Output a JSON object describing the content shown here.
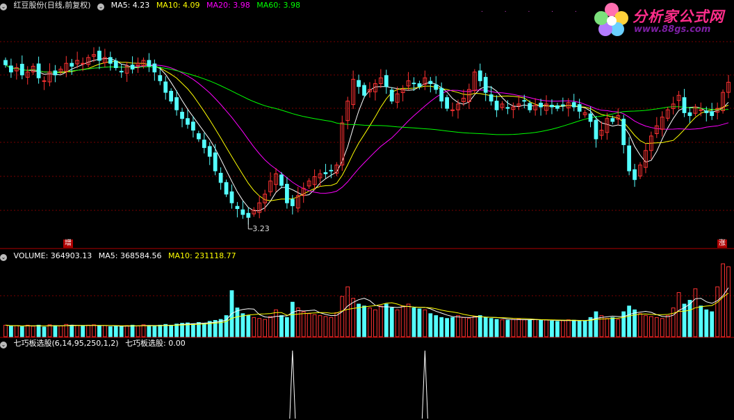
{
  "header_main": {
    "stock_title": "红豆股份(日线,前复权)",
    "ma5": "MA5: 4.23",
    "ma10": "MA10: 4.09",
    "ma20": "MA20: 3.98",
    "ma60": "MA60: 3.98"
  },
  "header_volume": {
    "volume": "VOLUME: 364903.13",
    "ma5": "MA5: 368584.56",
    "ma10": "MA10: 231118.77"
  },
  "header_indicator": {
    "name": "七巧板选股(6,14,95,250,1,2)",
    "value": "七巧板选股: 0.00"
  },
  "annotations": {
    "low_price": "3.23",
    "badge_left": "增",
    "badge_right": "涨",
    "logo_text": "分析家公式网",
    "logo_url": "www.88gs.com",
    "dots": ". . . . . ."
  },
  "colors": {
    "up": "#ff3232",
    "down": "#54ffff",
    "ma5": "#ffffff",
    "ma10": "#ffff00",
    "ma20": "#ff00ff",
    "ma60": "#00ff00",
    "grid": "#7a0000",
    "signal": "#ffffff"
  },
  "chart_data": [
    {
      "type": "candlestick",
      "title": "红豆股份(日线,前复权)",
      "ylim": [
        3.1,
        4.7
      ],
      "close": [
        4.35,
        4.3,
        4.33,
        4.28,
        4.3,
        4.34,
        4.26,
        4.24,
        4.3,
        4.28,
        4.32,
        4.36,
        4.34,
        4.38,
        4.36,
        4.4,
        4.42,
        4.38,
        4.4,
        4.36,
        4.33,
        4.3,
        4.34,
        4.32,
        4.36,
        4.38,
        4.34,
        4.3,
        4.24,
        4.16,
        4.1,
        4.04,
        3.98,
        3.94,
        3.9,
        3.84,
        3.78,
        3.72,
        3.62,
        3.54,
        3.46,
        3.4,
        3.36,
        3.32,
        3.3,
        3.35,
        3.4,
        3.46,
        3.55,
        3.6,
        3.52,
        3.4,
        3.38,
        3.45,
        3.5,
        3.55,
        3.58,
        3.6,
        3.6,
        3.62,
        3.66,
        3.95,
        4.1,
        4.25,
        4.2,
        4.14,
        4.18,
        4.22,
        4.26,
        4.2,
        4.1,
        4.15,
        4.18,
        4.24,
        4.22,
        4.2,
        4.26,
        4.22,
        4.18,
        4.1,
        4.05,
        4.04,
        4.08,
        4.12,
        4.18,
        4.3,
        4.24,
        4.16,
        4.1,
        4.04,
        4.08,
        4.05,
        4.06,
        4.08,
        4.1,
        4.04,
        4.07,
        4.06,
        4.08,
        4.06,
        4.05,
        4.07,
        4.09,
        4.06,
        4.03,
        4.02,
        3.96,
        3.84,
        3.9,
        3.98,
        3.96,
        4.0,
        3.8,
        3.62,
        3.56,
        3.66,
        3.76,
        3.86,
        3.93,
        3.99,
        4.04,
        4.08,
        4.14,
        4.02,
        4.0,
        4.06,
        4.04,
        4.02,
        4.0,
        4.05,
        4.16,
        4.23
      ]
    },
    {
      "type": "bar",
      "title": "VOLUME",
      "values": [
        60,
        55,
        58,
        52,
        60,
        55,
        60,
        50,
        62,
        58,
        56,
        64,
        60,
        58,
        55,
        60,
        62,
        56,
        58,
        52,
        55,
        54,
        58,
        60,
        56,
        62,
        58,
        55,
        60,
        64,
        60,
        66,
        70,
        72,
        68,
        74,
        70,
        80,
        85,
        90,
        110,
        240,
        150,
        120,
        110,
        100,
        95,
        90,
        105,
        140,
        110,
        100,
        180,
        150,
        130,
        120,
        115,
        110,
        105,
        100,
        125,
        210,
        260,
        200,
        170,
        160,
        150,
        140,
        160,
        170,
        150,
        140,
        160,
        170,
        150,
        145,
        140,
        120,
        110,
        100,
        95,
        100,
        110,
        100,
        95,
        105,
        110,
        100,
        95,
        90,
        88,
        86,
        90,
        92,
        88,
        86,
        90,
        85,
        88,
        82,
        80,
        84,
        88,
        86,
        80,
        82,
        100,
        130,
        110,
        95,
        100,
        90,
        130,
        160,
        140,
        120,
        110,
        105,
        100,
        95,
        110,
        150,
        230,
        170,
        190,
        250,
        160,
        140,
        130,
        260,
        380,
        364.9
      ]
    },
    {
      "type": "line",
      "title": "七巧板选股",
      "signal_at": [
        52,
        76
      ],
      "value": 0.0
    }
  ]
}
